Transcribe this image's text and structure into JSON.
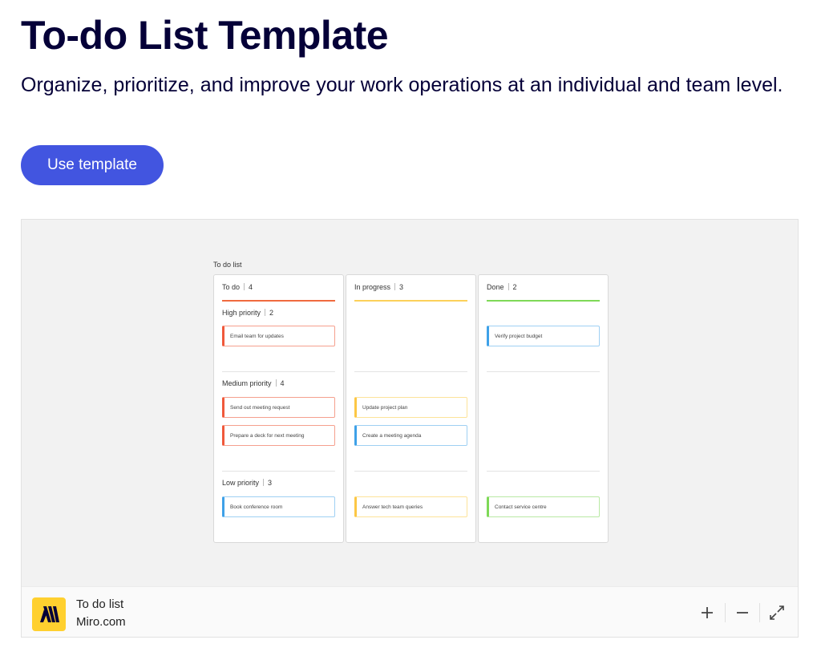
{
  "header": {
    "title": "To-do List Template",
    "subtitle": "Organize, prioritize, and improve your work operations at an individual and team level.",
    "cta_label": "Use template"
  },
  "board": {
    "title": "To do list",
    "columns": [
      {
        "name": "To do",
        "count": "4",
        "accent": "#f06a3f"
      },
      {
        "name": "In progress",
        "count": "3",
        "accent": "#fcd15a"
      },
      {
        "name": "Done",
        "count": "2",
        "accent": "#7ed957"
      }
    ],
    "sections": [
      {
        "name": "High priority",
        "count": "2"
      },
      {
        "name": "Medium priority",
        "count": "4"
      },
      {
        "name": "Low priority",
        "count": "3"
      }
    ],
    "cards": {
      "todo_high_1": {
        "text": "Email team for updates",
        "color": "#f0593b"
      },
      "done_high_1": {
        "text": "Verify project budget",
        "color": "#3ea1e8"
      },
      "todo_med_1": {
        "text": "Send out meeting request",
        "color": "#f0593b"
      },
      "todo_med_2": {
        "text": "Prepare a deck for next meeting",
        "color": "#f0593b"
      },
      "prog_med_1": {
        "text": "Update project plan",
        "color": "#fcc745"
      },
      "prog_med_2": {
        "text": "Create a meeting agenda",
        "color": "#3ea1e8"
      },
      "todo_low_1": {
        "text": "Book conference room",
        "color": "#3ea1e8"
      },
      "prog_low_1": {
        "text": "Answer tech team queries",
        "color": "#fcc745"
      },
      "done_low_1": {
        "text": "Contact service centre",
        "color": "#7ed957"
      }
    }
  },
  "footer": {
    "title": "To do list",
    "subtitle": "Miro.com",
    "logo_icon": "miro-logo-icon",
    "controls": [
      "zoom-in-icon",
      "zoom-out-icon",
      "fullscreen-icon"
    ]
  }
}
